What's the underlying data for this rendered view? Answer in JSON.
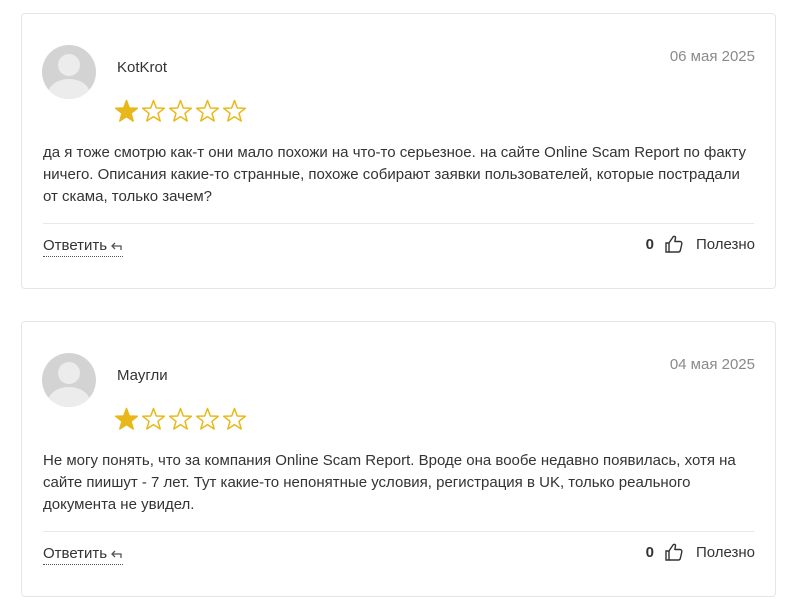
{
  "reviews": [
    {
      "author": "KotKrot",
      "date": "06 мая 2025",
      "rating": 1,
      "max_rating": 5,
      "text": "да я тоже смотрю как-т они мало похожи на что-то серьезное. на сайте Online Scam Report по факту ничего. Описания какие-то странные, похоже собирают заявки пользователей, которые пострадали от скама, только зачем?",
      "reply_label": "Ответить",
      "helpful_count": "0",
      "helpful_label": "Полезно"
    },
    {
      "author": "Маугли",
      "date": "04 мая 2025",
      "rating": 1,
      "max_rating": 5,
      "text": "Не могу понять, что за компания Online Scam Report. Вроде она вообе недавно появилась, хотя на сайте пиишут - 7 лет. Тут какие-то непонятные условия, регистрация в UK, только реального документа не увидел.",
      "reply_label": "Ответить",
      "helpful_count": "0",
      "helpful_label": "Полезно"
    }
  ],
  "colors": {
    "star": "#e8b81a",
    "border": "#e6e6e6",
    "date": "#8a8a8a",
    "avatar": "#d3d3d3"
  },
  "icons": {
    "star": "star-icon",
    "reply": "reply-arrow-icon",
    "like": "thumbs-up-icon"
  }
}
